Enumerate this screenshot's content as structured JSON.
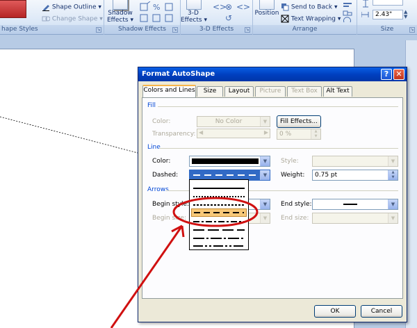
{
  "ribbon": {
    "shape_styles_label": "hape Styles",
    "shape_outline_label": "Shape Outline",
    "change_shape_label": "Change Shape",
    "shadow_effects_btn_line1": "Shadow",
    "shadow_effects_btn_line2": "Effects",
    "shadow_effects_label": "Shadow Effects",
    "threed_btn_line1": "3-D",
    "threed_btn_line2": "Effects",
    "threed_effects_label": "3-D Effects",
    "position_label": "Position",
    "send_to_back_label": "Send to Back",
    "text_wrapping_label": "Text Wrapping",
    "arrange_label": "Arrange",
    "size_label": "Size",
    "width_value": "2.43\"",
    "accent_red": "#c0392b"
  },
  "dialog": {
    "title": "Format AutoShape",
    "help_symbol": "?",
    "close_symbol": "✕",
    "tabs": [
      {
        "label": "Colors and Lines",
        "state": "active"
      },
      {
        "label": "Size",
        "state": "normal"
      },
      {
        "label": "Layout",
        "state": "normal"
      },
      {
        "label": "Picture",
        "state": "disabled"
      },
      {
        "label": "Text Box",
        "state": "disabled"
      },
      {
        "label": "Alt Text",
        "state": "normal"
      }
    ],
    "fill": {
      "section": "Fill",
      "color_label": "Color:",
      "color_value": "No Color",
      "fill_effects_label": "Fill Effects...",
      "transparency_label": "Transparency:",
      "transparency_value": "0 %"
    },
    "line": {
      "section": "Line",
      "color_label": "Color:",
      "dashed_label": "Dashed:",
      "style_label": "Style:",
      "weight_label": "Weight:",
      "weight_value": "0.75 pt"
    },
    "arrows": {
      "section": "Arrows",
      "begin_style_label": "Begin style:",
      "begin_size_label": "Begin size:",
      "end_style_label": "End style:",
      "end_size_label": "End size:"
    },
    "ok_label": "OK",
    "cancel_label": "Cancel",
    "dash_options": [
      "solid",
      "round-dot",
      "square-dot",
      "dash",
      "dash-dot",
      "long-dash",
      "long-dash-dot",
      "long-dash-dot-dot"
    ],
    "selected_dash": "dash"
  },
  "colors": {
    "title_bar": "#0a46d5",
    "selection_highlight": "#f8c878",
    "annotation": "#d01010"
  }
}
